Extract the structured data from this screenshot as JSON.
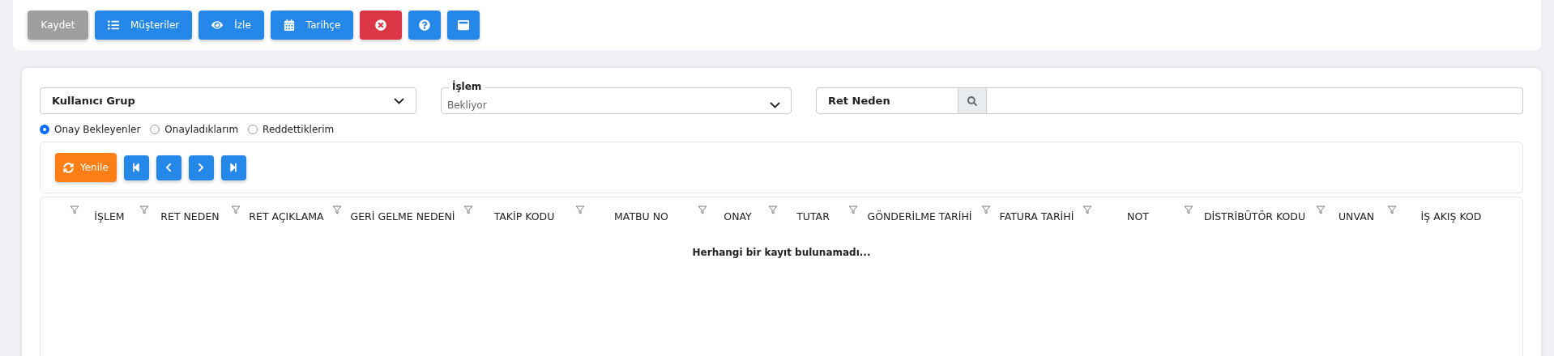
{
  "toolbar": [
    {
      "kind": "save",
      "label": "Kaydet",
      "color": "#9e9e9e"
    },
    {
      "kind": "customers",
      "label": "Müşteriler",
      "color": "#2588e8"
    },
    {
      "kind": "view",
      "label": "İzle",
      "color": "#2588e8"
    },
    {
      "kind": "history",
      "label": "Tarihçe",
      "color": "#2588e8"
    },
    {
      "kind": "close",
      "color": "#dc3545"
    },
    {
      "kind": "help",
      "color": "#2588e8"
    },
    {
      "kind": "window",
      "color": "#2588e8"
    }
  ],
  "filters": {
    "user_group": {
      "value": "Kullanıcı Grup"
    },
    "islem": {
      "label": "İşlem",
      "value": "Bekliyor"
    },
    "ret_neden": {
      "label": "Ret Neden"
    }
  },
  "radios": [
    {
      "label": "Onay Bekleyenler",
      "selected": true
    },
    {
      "label": "Onayladıklarım",
      "selected": false
    },
    {
      "label": "Reddettiklerim",
      "selected": false
    }
  ],
  "grid_toolbar": [
    {
      "kind": "refresh",
      "label": "Yenile"
    },
    {
      "kind": "first"
    },
    {
      "kind": "prev"
    },
    {
      "kind": "next"
    },
    {
      "kind": "last"
    }
  ],
  "table": {
    "columns": [
      "İŞLEM",
      "RET NEDEN",
      "RET AÇIKLAMA",
      "GERİ GELME NEDENİ",
      "TAKİP KODU",
      "MATBU NO",
      "ONAY",
      "TUTAR",
      "GÖNDERİLME TARİHİ",
      "FATURA TARİHİ",
      "NOT",
      "DİSTRİBÜTÖR KODU",
      "UNVAN",
      "İŞ AKIŞ KOD"
    ],
    "empty_message": "Herhangi bir kayıt bulunamadı..."
  }
}
